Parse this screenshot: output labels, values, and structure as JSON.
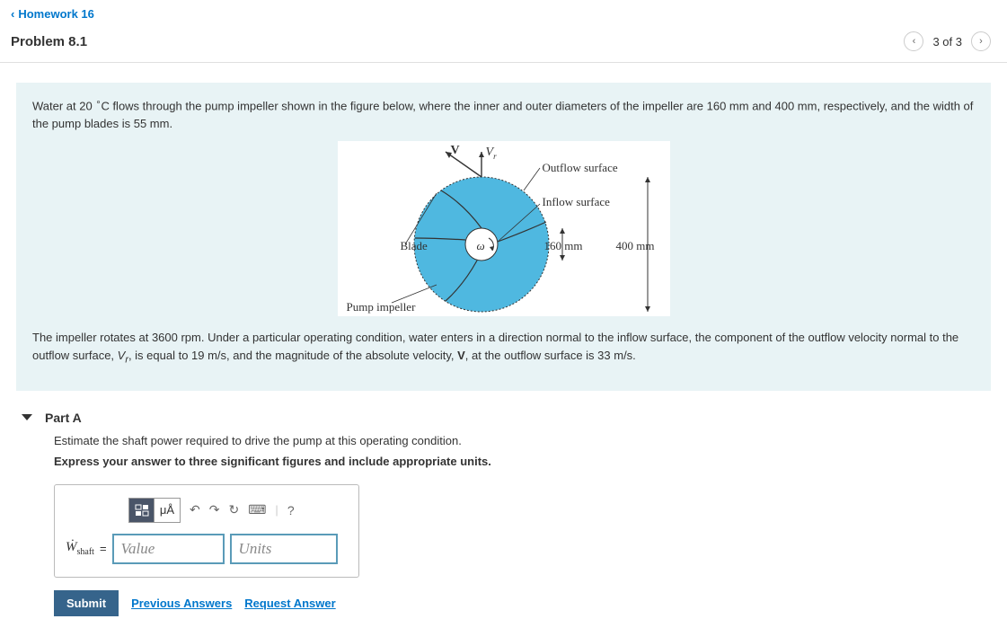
{
  "breadcrumb": {
    "label": "Homework 16"
  },
  "header": {
    "title": "Problem 8.1",
    "nav_count": "3 of 3"
  },
  "problem": {
    "intro_html": "Water at 20 °C flows through the pump impeller shown in the figure below, where the inner and outer diameters of the impeller are 160 mm and 400 mm, respectively, and the width of the pump blades is 55 mm.",
    "details_html": "The impeller rotates at 3600 rpm. Under a particular operating condition, water enters in a direction normal to the inflow surface, the component of the outflow velocity normal to the outflow surface, Vᵣ, is equal to 19 m/s, and the magnitude of the absolute velocity, V, at the outflow surface is 33 m/s."
  },
  "figure": {
    "label_V": "V",
    "label_Vr": "Vᵣ",
    "label_outflow": "Outflow surface",
    "label_inflow": "Inflow surface",
    "label_blade": "Blade",
    "label_omega": "ω",
    "label_inner": "160 mm",
    "label_outer": "400 mm",
    "label_pump": "Pump impeller"
  },
  "part": {
    "title": "Part A",
    "instruction": "Estimate the shaft power required to drive the pump at this operating condition.",
    "instruction2": "Express your answer to three significant figures and include appropriate units.",
    "var_label": "Ẇ",
    "var_sub": "shaft",
    "equals": " = ",
    "value_ph": "Value",
    "units_ph": "Units",
    "tb_sigma": "μÅ",
    "tb_help": "?",
    "submit": "Submit",
    "prev": "Previous Answers",
    "req": "Request Answer"
  }
}
